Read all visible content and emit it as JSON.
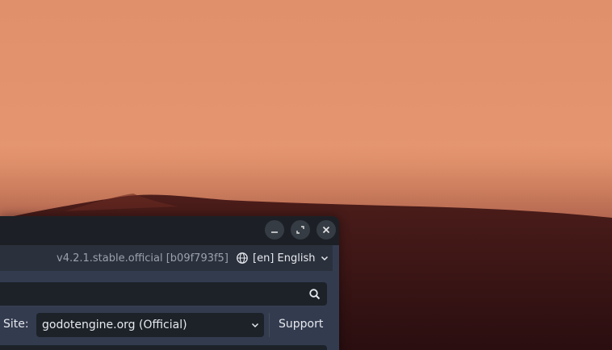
{
  "window": {
    "controls": {
      "minimize": "minimize-icon",
      "maximize": "maximize-icon",
      "close": "close-icon"
    }
  },
  "topbar": {
    "version": "v4.2.1.stable.official [b09f793f5]",
    "language": {
      "icon": "globe-icon",
      "label": "[en] English"
    }
  },
  "search": {
    "placeholder": "",
    "icon": "search-icon"
  },
  "site": {
    "label": "Site:",
    "selected": "godotengine.org (Official)",
    "support_label": "Support"
  },
  "colors": {
    "window_bg": "#252b33",
    "panel_bg": "#333b4f",
    "field_bg": "#1d2229",
    "text": "#e6e9ee",
    "muted_text": "#9aa1ad"
  }
}
